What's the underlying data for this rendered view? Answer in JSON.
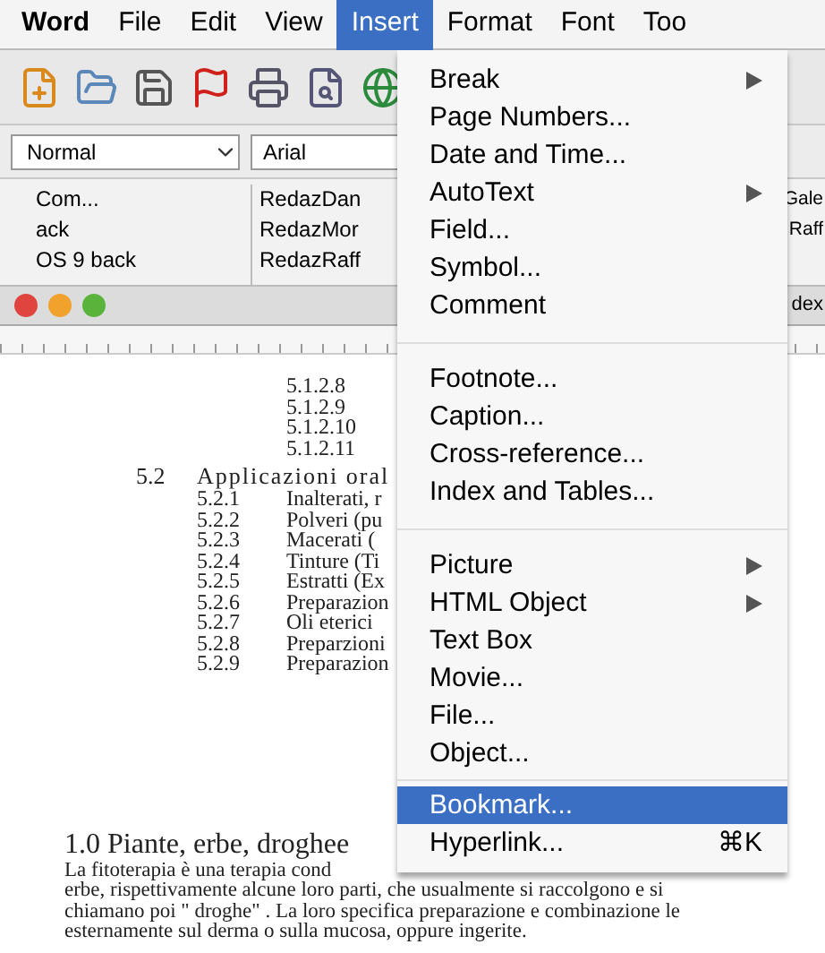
{
  "menu_bar": [
    {
      "label": "Word",
      "selected": false
    },
    {
      "label": "File",
      "selected": false
    },
    {
      "label": "Edit",
      "selected": false
    },
    {
      "label": "View",
      "selected": false
    },
    {
      "label": "Insert",
      "selected": true
    },
    {
      "label": "Format",
      "selected": false
    },
    {
      "label": "Font",
      "selected": false
    },
    {
      "label": "Too",
      "selected": false
    }
  ],
  "format_bar": {
    "style": "Normal",
    "font": "Arial"
  },
  "file_panel": {
    "left_items": [
      "Com...",
      "ack",
      "OS 9 back"
    ],
    "middle_items": [
      "RedazDan",
      "RedazMor",
      "RedazRaff"
    ],
    "right_items": [
      "Gale",
      "Raff"
    ]
  },
  "document_window": {
    "title": "dex"
  },
  "document": {
    "sub_items": [
      "5.1.2.8",
      "5.1.2.9",
      "5.1.2.10",
      "5.1.2.11"
    ],
    "section": {
      "number": "5.2",
      "title": "Applicazioni oral"
    },
    "section_items": [
      {
        "number": "5.2.1",
        "text": "Inalterati, r"
      },
      {
        "number": "5.2.2",
        "text": "Polveri (pu"
      },
      {
        "number": "5.2.3",
        "text": "Macerati ("
      },
      {
        "number": "5.2.4",
        "text": "Tinture (Ti"
      },
      {
        "number": "5.2.5",
        "text": "Estratti (Ex"
      },
      {
        "number": "5.2.6",
        "text": "Preparazion"
      },
      {
        "number": "5.2.7",
        "text": "Oli eterici"
      },
      {
        "number": "5.2.8",
        "text": "Preparzioni"
      },
      {
        "number": "5.2.9",
        "text": "Preparazion"
      }
    ],
    "heading": "1.0 Piante, erbe, droghee",
    "paragraph_lines": [
      "La fitoterapia è una terapia cond",
      "erbe, rispettivamente alcune loro parti, che usualmente si raccolgono e si",
      "chiamano poi \" droghe\" . La loro specifica preparazione e combinazione le",
      "esternamente sul derma o sulla mucosa, oppure ingerite."
    ]
  },
  "insert_menu": [
    [
      {
        "label": "Break",
        "submenu": true,
        "selected": false
      },
      {
        "label": "Page Numbers...",
        "submenu": false,
        "selected": false
      },
      {
        "label": "Date and Time...",
        "submenu": false,
        "selected": false
      },
      {
        "label": "AutoText",
        "submenu": true,
        "selected": false
      },
      {
        "label": "Field...",
        "submenu": false,
        "selected": false
      },
      {
        "label": "Symbol...",
        "submenu": false,
        "selected": false
      },
      {
        "label": "Comment",
        "submenu": false,
        "selected": false
      }
    ],
    [
      {
        "label": "Footnote...",
        "submenu": false,
        "selected": false
      },
      {
        "label": "Caption...",
        "submenu": false,
        "selected": false
      },
      {
        "label": "Cross-reference...",
        "submenu": false,
        "selected": false
      },
      {
        "label": "Index and Tables...",
        "submenu": false,
        "selected": false
      }
    ],
    [
      {
        "label": "Picture",
        "submenu": true,
        "selected": false
      },
      {
        "label": "HTML Object",
        "submenu": true,
        "selected": false
      },
      {
        "label": "Text Box",
        "submenu": false,
        "selected": false
      },
      {
        "label": "Movie...",
        "submenu": false,
        "selected": false
      },
      {
        "label": "File...",
        "submenu": false,
        "selected": false
      },
      {
        "label": "Object...",
        "submenu": false,
        "selected": false
      }
    ],
    [
      {
        "label": "Bookmark...",
        "submenu": false,
        "selected": true
      },
      {
        "label": "Hyperlink...",
        "submenu": false,
        "selected": false,
        "shortcut": "⌘K"
      }
    ]
  ]
}
